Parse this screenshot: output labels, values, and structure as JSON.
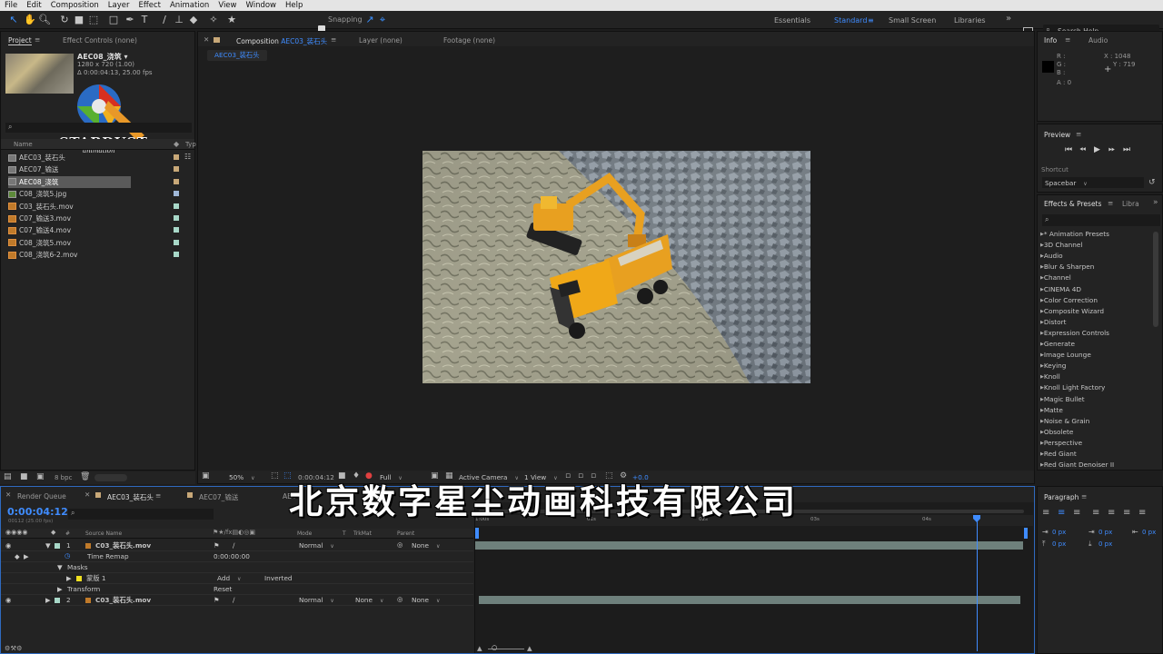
{
  "menu": [
    "File",
    "Edit",
    "Composition",
    "Layer",
    "Effect",
    "Animation",
    "View",
    "Window",
    "Help"
  ],
  "toolbar": {
    "snapping_label": "Snapping",
    "workspaces": [
      "Essentials",
      "Standard",
      "Small Screen",
      "Libraries"
    ],
    "active_workspace": "Standard",
    "search_help_placeholder": "Search Help"
  },
  "project": {
    "tabs": [
      "Project",
      "Effect Controls (none)"
    ],
    "selected_name": "AEC08_浇筑 ▾",
    "selected_size": "1280 x 720 (1.00)",
    "selected_info": "Δ 0:00:04:13, 25.00 fps",
    "column_name": "Name",
    "column_type": "Typ",
    "items": [
      {
        "name": "AEC03_装石头",
        "kind": "comp",
        "tag": "#c8a878"
      },
      {
        "name": "AEC07_输送",
        "kind": "comp",
        "tag": "#c8a878"
      },
      {
        "name": "AEC08_浇筑",
        "kind": "comp",
        "tag": "#c8a878",
        "selected": true
      },
      {
        "name": "C08_浇筑5.jpg",
        "kind": "img",
        "tag": "#a0b8d8"
      },
      {
        "name": "C03_装石头.mov",
        "kind": "mov",
        "tag": "#a8d8c8"
      },
      {
        "name": "C07_输送3.mov",
        "kind": "mov",
        "tag": "#a8d8c8"
      },
      {
        "name": "C07_输送4.mov",
        "kind": "mov",
        "tag": "#a8d8c8"
      },
      {
        "name": "C08_浇筑5.mov",
        "kind": "mov",
        "tag": "#a8d8c8"
      },
      {
        "name": "C08_浇筑6-2.mov",
        "kind": "mov",
        "tag": "#a8d8c8"
      }
    ],
    "bpc": "8 bpc"
  },
  "watermark": {
    "logo_text": "STARDUST",
    "sub_text": "animation"
  },
  "viewer": {
    "tabs": [
      "Composition AEC03_装石头",
      "Layer (none)",
      "Footage (none)"
    ],
    "comp_name_prefix": "Composition ",
    "comp_name": "AEC03_装石头",
    "subtab": "AEC03_装石头",
    "zoom": "50%",
    "timecode": "0:00:04:12",
    "resolution": "Full",
    "camera": "Active Camera",
    "view": "1 View",
    "exposure": "+0.0"
  },
  "info": {
    "tabs": [
      "Info",
      "Audio"
    ],
    "r": "R :",
    "g": "G :",
    "b": "B :",
    "a": "A : 0",
    "x": "X : 1048",
    "y": "Y : 719"
  },
  "preview": {
    "title": "Preview",
    "shortcut_label": "Shortcut",
    "shortcut_value": "Spacebar"
  },
  "effects": {
    "tabs": [
      "Effects & Presets",
      "Libra"
    ],
    "items": [
      "* Animation Presets",
      "3D Channel",
      "Audio",
      "Blur & Sharpen",
      "Channel",
      "CINEMA 4D",
      "Color Correction",
      "Composite Wizard",
      "Distort",
      "Expression Controls",
      "Generate",
      "Image Lounge",
      "Keying",
      "Knoll",
      "Knoll Light Factory",
      "Magic Bullet",
      "Matte",
      "Noise & Grain",
      "Obsolete",
      "Perspective",
      "Red Giant",
      "Red Giant Denoiser II"
    ]
  },
  "paragraph": {
    "title": "Paragraph",
    "values": [
      "0 px",
      "0 px",
      "0 px",
      "0 px",
      "0 px"
    ]
  },
  "timeline": {
    "tabs": [
      "Render Queue",
      "AEC03_装石头",
      "AEC07_输送",
      "AEC"
    ],
    "timecode": "0:00:04:12",
    "frame_info": "00112 (25.00 fps)",
    "col_source": "Source Name",
    "col_mode": "Mode",
    "col_t": "T",
    "col_trkmat": "TrkMat",
    "col_parent": "Parent",
    "rulers": [
      "1:00s",
      "01s",
      "02s",
      "03s",
      "04s"
    ],
    "playhead_fraction": 0.92,
    "layers": [
      {
        "num": "1",
        "name": "C03_装石头.mov",
        "mode": "Normal",
        "trkmat": "",
        "parent": "None"
      },
      {
        "num": "2",
        "name": "C03_装石头.mov",
        "mode": "Normal",
        "trkmat": "None",
        "parent": "None"
      }
    ],
    "time_remap_label": "Time Remap",
    "time_remap_value": "0:00:00:00",
    "masks_label": "Masks",
    "mask_name": "蒙版 1",
    "mask_mode": "Add",
    "mask_inverted": "Inverted",
    "transform_label": "Transform",
    "transform_reset": "Reset"
  },
  "overlay_text": "北京数字星尘动画科技有限公司"
}
